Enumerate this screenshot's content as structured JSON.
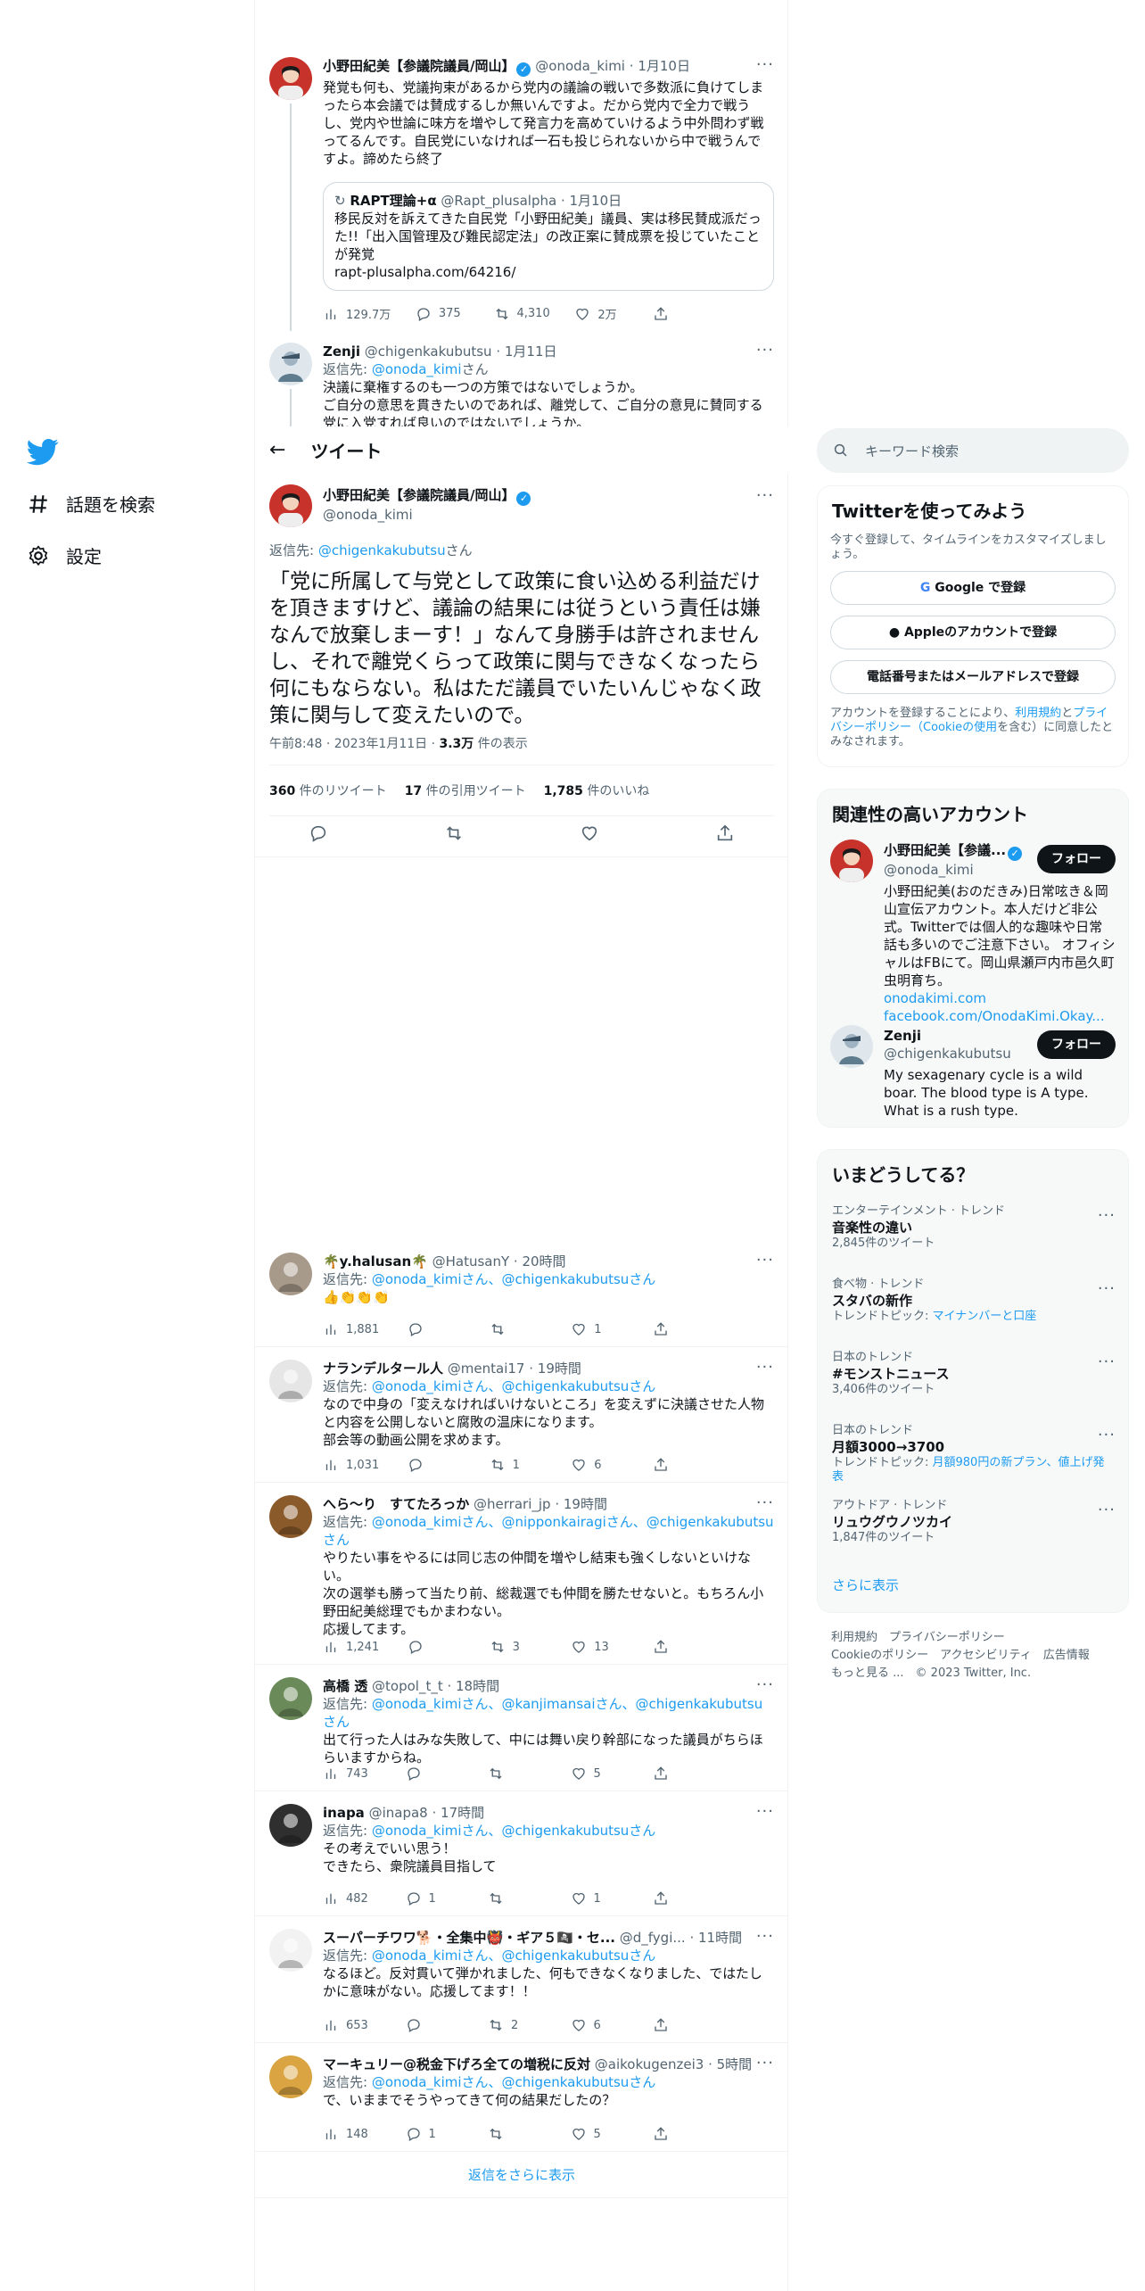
{
  "colors": {
    "accent": "#1d9bf0",
    "text": "#0f1419",
    "muted": "#536471",
    "follow_bg": "#0f1419"
  },
  "nav": {
    "explore": "話題を検索",
    "settings": "設定"
  },
  "thread": [
    {
      "name": "小野田紀美【参議院議員/岡山】",
      "handle": "@onoda_kimi",
      "time": "1月10日",
      "text": "発覚も何も、党議拘束があるから党内の議論の戦いで多数派に負けてしまったら本会議では賛成するしか無いんですよ。だから党内で全力で戦うし、党内や世論に味方を増やして発言力を高めていけるよう中外問わず戦ってるんです。自民党にいなければ一石も投じられないから中で戦うんですよ。諦めたら終了",
      "quote": {
        "name": "RAPT理論+α",
        "handle": "@Rapt_plusalpha",
        "time": "1月10日",
        "text": "移民反対を訴えてきた自民党「小野田紀美」議員、実は移民賛成派だった!!「出入国管理及び難民認定法」の改正案に賛成票を投じていたことが発覚",
        "link": "rapt-plusalpha.com/64216/"
      },
      "views": "129.7万",
      "replies": "375",
      "retweets": "4,310",
      "likes": "2万"
    },
    {
      "name": "Zenji",
      "handle": "@chigenkakubutsu",
      "time": "1月11日",
      "reply_label": "返信先:",
      "reply_to": "@onoda_kimi",
      "reply_suffix": "さん",
      "text": "決議に棄権するのも一つの方策ではないでしょうか。\nご自分の意思を貫きたいのであれば、離党して、ご自分の意見に賛同する党に入党すれば良いのではないでしょうか。"
    }
  ],
  "header": {
    "title": "ツイート"
  },
  "main_tweet": {
    "name": "小野田紀美【参議院議員/岡山】",
    "handle": "@onoda_kimi",
    "reply_label": "返信先:",
    "reply_to": "@chigenkakubutsu",
    "reply_suffix": "さん",
    "text": "「党に所属して与党として政策に食い込める利益だけを頂きますけど、議論の結果には従うという責任は嫌なんで放棄しまーす！」なんて身勝手は許されませんし、それで離党くらって政策に関与できなくなったら何にもならない。私はただ議員でいたいんじゃなく政策に関与して変えたいので。",
    "time": "午前8:48 · 2023年1月11日 · ",
    "views_count": "3.3万",
    "views_label": " 件の表示",
    "retweets_count": "360",
    "retweets_label": " 件のリツイート",
    "quotes_count": "17",
    "quotes_label": " 件の引用ツイート",
    "likes_count": "1,785",
    "likes_label": " 件のいいね"
  },
  "replies": [
    {
      "name": "🌴y.halusan🌴",
      "handle": "@HatusanY",
      "time": "20時間",
      "reply_label": "返信先:",
      "mentions": "@onoda_kimiさん、@chigenkakubutsuさん",
      "text": "👍👏👏👏",
      "views": "1,881",
      "replies": "",
      "retweets": "",
      "likes": "1"
    },
    {
      "name": "ナランデルタール人",
      "handle": "@mentai17",
      "time": "19時間",
      "reply_label": "返信先:",
      "mentions": "@onoda_kimiさん、@chigenkakubutsuさん",
      "text": "なので中身の「変えなければいけないところ」を変えずに決議させた人物と内容を公開しないと腐敗の温床になります。\n部会等の動画公開を求めます。",
      "views": "1,031",
      "replies": "",
      "retweets": "1",
      "likes": "6"
    },
    {
      "name": "へら～り　すてたろっか",
      "handle": "@herrari_jp",
      "time": "19時間",
      "reply_label": "返信先:",
      "mentions": "@onoda_kimiさん、@nipponkairagiさん、@chigenkakubutsuさん",
      "text": "やりたい事をやるには同じ志の仲間を増やし結束も強くしないといけない。\n次の選挙も勝って当たり前、総裁選でも仲間を勝たせないと。もちろん小野田紀美総理でもかまわない。\n応援してます。",
      "views": "1,241",
      "replies": "",
      "retweets": "3",
      "likes": "13"
    },
    {
      "name": "高橋 透",
      "handle": "@topol_t_t",
      "time": "18時間",
      "reply_label": "返信先:",
      "mentions": "@onoda_kimiさん、@kanjimansaiさん、@chigenkakubutsuさん",
      "text": "出て行った人はみな失敗して、中には舞い戻り幹部になった議員がちらほらいますからね。",
      "views": "743",
      "replies": "",
      "retweets": "",
      "likes": "5"
    },
    {
      "name": "inapa",
      "handle": "@inapa8",
      "time": "17時間",
      "reply_label": "返信先:",
      "mentions": "@onoda_kimiさん、@chigenkakubutsuさん",
      "text": "その考えでいい思う！\nできたら、衆院議員目指して",
      "views": "482",
      "replies": "1",
      "retweets": "",
      "likes": "1"
    },
    {
      "name": "スーパーチワワ🐕・全集中👹・ギア５🏴‍☠️・セ...",
      "handle": "@d_fygi...",
      "time": "11時間",
      "reply_label": "返信先:",
      "mentions": "@onoda_kimiさん、@chigenkakubutsuさん",
      "text": "なるほど。反対貫いて弾かれました、何もできなくなりました、ではたしかに意味がない。応援してます！！",
      "views": "653",
      "replies": "",
      "retweets": "2",
      "likes": "6"
    },
    {
      "name": "マーキュリー@税金下げろ全ての増税に反対",
      "handle": "@aikokugenzei3",
      "time": "5時間",
      "reply_label": "返信先:",
      "mentions": "@onoda_kimiさん、@chigenkakubutsuさん",
      "text": "で、いままでそうやってきて何の結果だしたの？",
      "views": "148",
      "replies": "1",
      "retweets": "",
      "likes": "5"
    }
  ],
  "show_more_replies": "返信をさらに表示",
  "search": {
    "placeholder": "キーワード検索"
  },
  "signup": {
    "title": "Twitterを使ってみよう",
    "subtitle": "今すぐ登録して、タイムラインをカスタマイズしましょう。",
    "google": "Google で登録",
    "apple": "Appleのアカウントで登録",
    "phone": "電話番号またはメールアドレスで登録",
    "legal_prefix": "アカウントを登録することにより、",
    "terms": "利用規約",
    "and": "と",
    "privacy": "プライバシーポリシー（Cookieの使用",
    "legal_suffix": "を含む）に同意したとみなされます。"
  },
  "relevant": {
    "title": "関連性の高いアカウント",
    "follow": "フォロー",
    "accounts": [
      {
        "name": "小野田紀美【参議...",
        "handle": "@onoda_kimi",
        "bio": "小野田紀美(おのだきみ)日常呟き＆岡山宣伝アカウント。本人だけど非公式。Twitterでは個人的な趣味や日常話も多いのでご注意下さい。 オフィシャルはFBにて。岡山県瀬戸内市邑久町虫明育ち。",
        "link1": "onodakimi.com",
        "link2": "facebook.com/OnodaKimi.Okay..."
      },
      {
        "name": "Zenji",
        "handle": "@chigenkakubutsu",
        "bio": "My sexagenary cycle is a wild boar. The blood type is A type. What is a rush type."
      }
    ]
  },
  "trends": {
    "title": "いまどうしてる？",
    "items": [
      {
        "category": "エンターテインメント · トレンド",
        "name": "音楽性の違い",
        "meta": "2,845件のツイート",
        "topic_label": "",
        "topic": ""
      },
      {
        "category": "食べ物 · トレンド",
        "name": "スタバの新作",
        "meta": "",
        "topic_label": "トレンドトピック: ",
        "topic": "マイナンバーと口座"
      },
      {
        "category": "日本のトレンド",
        "name": "#モンストニュース",
        "meta": "3,406件のツイート",
        "topic_label": "",
        "topic": ""
      },
      {
        "category": "日本のトレンド",
        "name": "月額3000→3700",
        "meta": "",
        "topic_label": "トレンドトピック: ",
        "topic": "月額980円の新プラン、値上げ発表"
      },
      {
        "category": "アウトドア · トレンド",
        "name": "リュウグウノツカイ",
        "meta": "1,847件のツイート",
        "topic_label": "",
        "topic": ""
      }
    ],
    "show_more": "さらに表示"
  },
  "footer": {
    "terms": "利用規約",
    "privacy": "プライバシーポリシー",
    "cookie": "Cookieのポリシー",
    "accessibility": "アクセシビリティ",
    "ads": "広告情報",
    "more": "もっと見る ...",
    "copyright": "© 2023 Twitter, Inc."
  }
}
